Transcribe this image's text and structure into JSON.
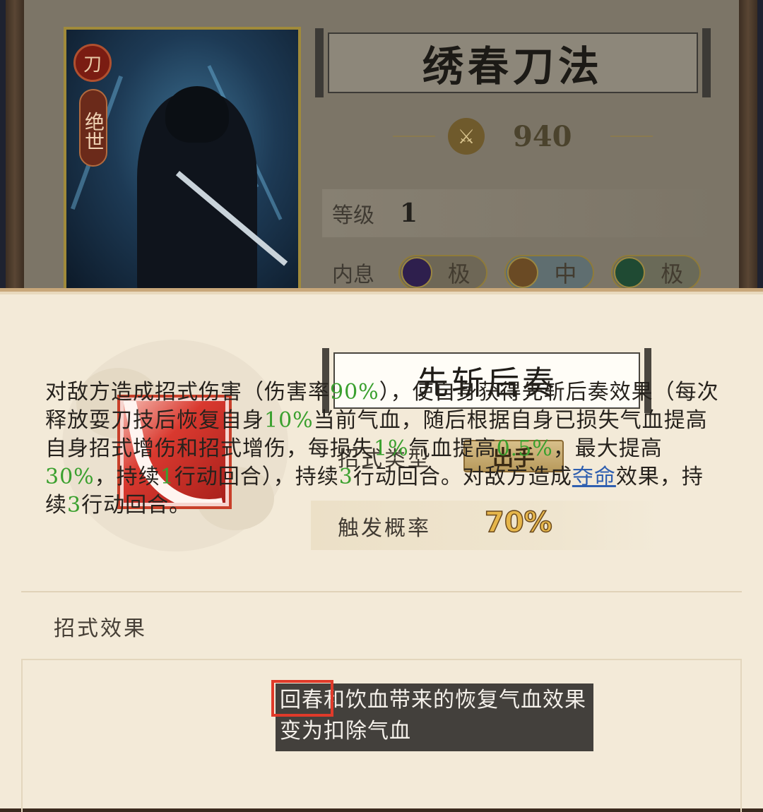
{
  "card": {
    "emblem_glyph": "刀",
    "rarity": "绝世"
  },
  "top": {
    "skill_title": "绣春刀法",
    "power_value": "940",
    "level_label": "等级",
    "level_value": "1",
    "neixi_label": "内息",
    "neixi": [
      {
        "grade": "极",
        "icon": "moon-orb-icon",
        "color": "#2e1f4d"
      },
      {
        "grade": "中",
        "icon": "sun-orb-icon",
        "color": "#6a4a24"
      },
      {
        "grade": "极",
        "icon": "ring-orb-icon",
        "color": "#1f4a33"
      }
    ]
  },
  "skill": {
    "name": "先斩后奏",
    "type_label": "招式类型",
    "type_value": "出手",
    "rate_label": "触发概率",
    "rate_value": "70%",
    "effect_title": "招式效果",
    "effect": {
      "p1": "对敌方造成招式伤害（伤害率",
      "v1": "90%",
      "p2": "），使自身获得先斩后奏效果（每次释放耍刀",
      "hidden": "技后恢复自身",
      "v2": "10%",
      "p3": "当前气血，随后根据自身已损失气血",
      "hidden2": "提高自身",
      "p4": "招式增伤和招式增伤，每损失",
      "v3": "1%",
      "p5": "气血提高",
      "v4": "0.5%",
      "p6": "，最大提高",
      "v5": "30%",
      "p7": "，持续",
      "v6": "1",
      "p8": "行动回合），持续",
      "v7": "3",
      "p9": "行动回合。对敌方造成",
      "link": "夺命",
      "p10": "效果，持续",
      "v8": "3",
      "p11": "行动回合。"
    }
  },
  "tooltip": {
    "text": "回春和饮血带来的恢复气血效果变为扣除气血"
  },
  "colors": {
    "highlight_green": "#3aa02e",
    "link_blue": "#2f5fb0",
    "rate_gold": "#e6b64b",
    "tooltip_border": "#e03a2a"
  }
}
